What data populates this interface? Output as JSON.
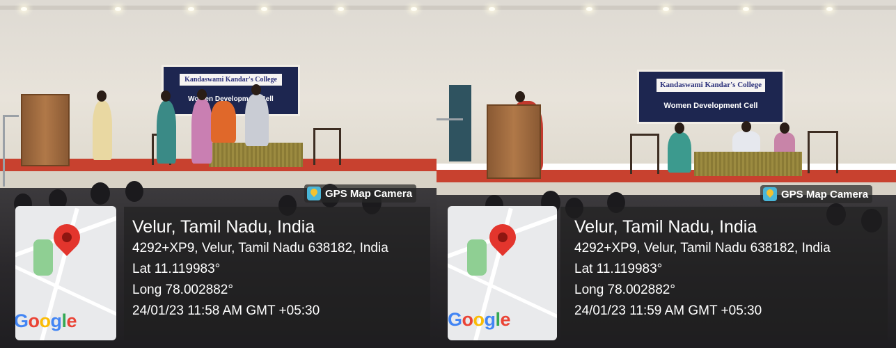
{
  "banner": {
    "title": "Kandaswami Kandar's College",
    "subtitle": "Women Development Cell"
  },
  "photos": [
    {
      "gps_label": "GPS Map Camera",
      "place": "Velur, Tamil Nadu, India",
      "address": "4292+XP9, Velur, Tamil Nadu 638182, India",
      "lat": "Lat 11.119983°",
      "long": "Long 78.002882°",
      "datetime": "24/01/23 11:58 AM GMT +05:30",
      "map_logo": "Google"
    },
    {
      "gps_label": "GPS Map Camera",
      "place": "Velur, Tamil Nadu, India",
      "address": "4292+XP9, Velur, Tamil Nadu 638182, India",
      "lat": "Lat 11.119983°",
      "long": "Long 78.002882°",
      "datetime": "24/01/23 11:59 AM GMT +05:30",
      "map_logo": "Google"
    }
  ],
  "colors": {
    "stage": "#c8412f",
    "banner": "#1d2650",
    "pin": "#e3352d"
  }
}
